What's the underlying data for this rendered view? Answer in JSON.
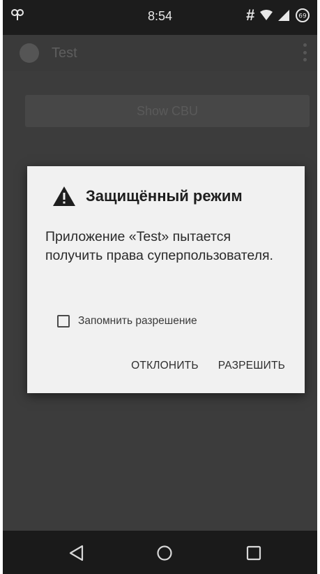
{
  "status_bar": {
    "time": "8:54",
    "hash": "#",
    "battery": "69"
  },
  "app_bar": {
    "title": "Test"
  },
  "content": {
    "show_button_label": "Show CBU"
  },
  "dialog": {
    "title": "Защищённый режим",
    "message": "Приложение «Test» пытается получить права суперпользователя.",
    "remember_label": "Запомнить разрешение",
    "remember_checked": false,
    "deny_label": "ОТКЛОНИТЬ",
    "allow_label": "РАЗРЕШИТЬ"
  },
  "nav_bar": {
    "icons": [
      "back-icon",
      "home-icon",
      "recent-apps-icon"
    ]
  },
  "colors": {
    "scrim_background": "#3c3c3c",
    "dialog_background": "#f1f1f1",
    "status_bar": "#1c1c1c",
    "nav_bar": "#1a1a1a"
  }
}
